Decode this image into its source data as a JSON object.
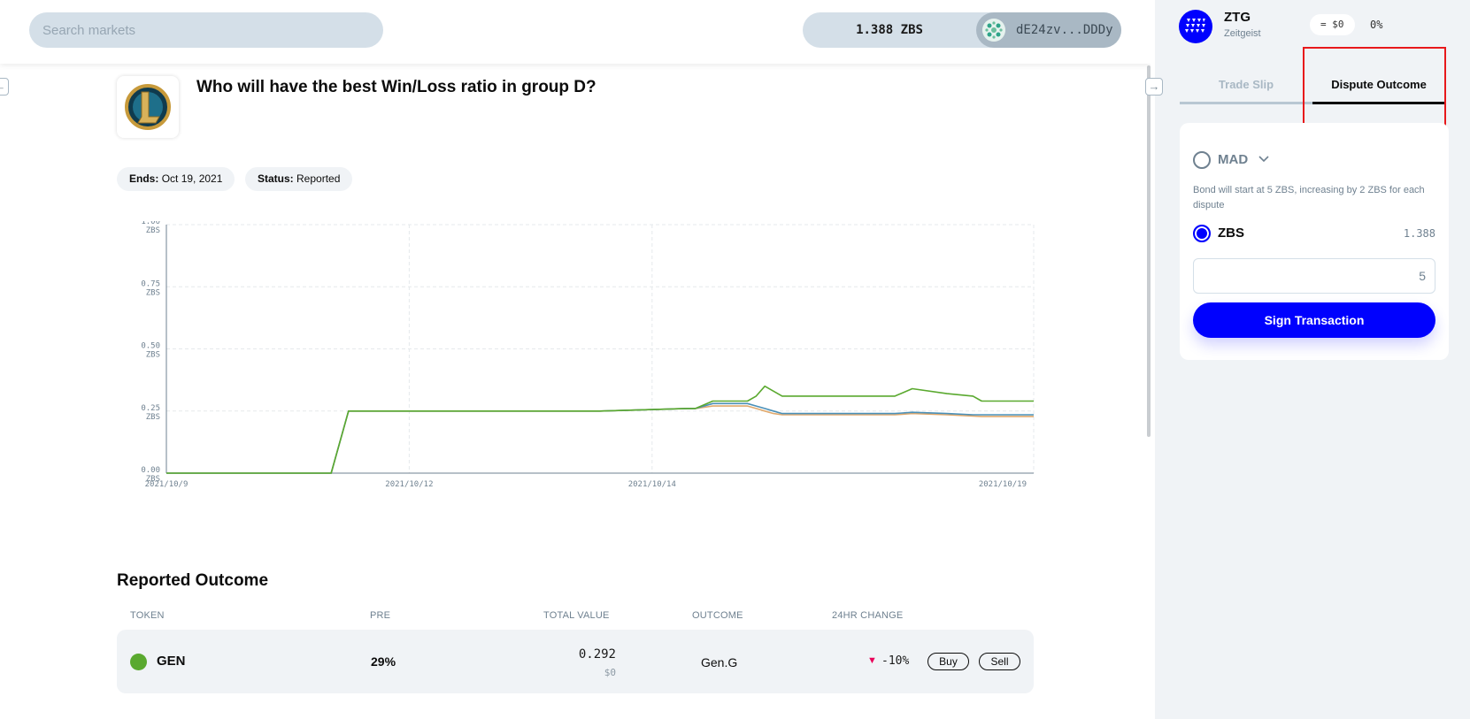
{
  "search": {
    "placeholder": "Search markets"
  },
  "wallet": {
    "balance": "1.388 ZBS",
    "address": "dE24zv...DDDy"
  },
  "market": {
    "question": "Who will have the best Win/Loss ratio in group D?",
    "ends_label": "Ends:",
    "ends_value": "Oct 19, 2021",
    "status_label": "Status:",
    "status_value": "Reported"
  },
  "chart_data": {
    "type": "line",
    "title": "",
    "xlabel": "",
    "ylabel": "",
    "x_ticks": [
      "2021/10/9",
      "2021/10/12",
      "2021/10/14",
      "2021/10/19"
    ],
    "y_ticks": [
      "0.00 ZBS",
      "0.25 ZBS",
      "0.50 ZBS",
      "0.75 ZBS",
      "1.00 ZBS"
    ],
    "ylim": [
      0,
      1
    ],
    "grid": true,
    "x": [
      0,
      0.19,
      0.21,
      0.35,
      0.5,
      0.6,
      0.61,
      0.63,
      0.67,
      0.68,
      0.69,
      0.7,
      0.71,
      0.75,
      0.84,
      0.86,
      0.9,
      0.93,
      0.94,
      1.0
    ],
    "series": [
      {
        "color": "#5aa92f",
        "values": [
          0,
          0,
          0.25,
          0.25,
          0.25,
          0.26,
          0.26,
          0.29,
          0.29,
          0.31,
          0.35,
          0.33,
          0.31,
          0.31,
          0.31,
          0.34,
          0.32,
          0.31,
          0.29,
          0.29
        ]
      },
      {
        "color": "#4a90b8",
        "values": [
          0,
          0,
          0.25,
          0.25,
          0.25,
          0.26,
          0.26,
          0.28,
          0.28,
          0.27,
          0.26,
          0.25,
          0.24,
          0.24,
          0.24,
          0.245,
          0.24,
          0.235,
          0.235,
          0.235
        ]
      },
      {
        "color": "#e0a96d",
        "values": [
          0,
          0,
          0.25,
          0.25,
          0.25,
          0.26,
          0.26,
          0.27,
          0.27,
          0.26,
          0.25,
          0.24,
          0.235,
          0.235,
          0.235,
          0.24,
          0.235,
          0.23,
          0.228,
          0.228
        ]
      }
    ],
    "colors": {
      "grid": "#e5e9ec",
      "axis": "#6f8190"
    }
  },
  "reported": {
    "title": "Reported Outcome",
    "columns": [
      "TOKEN",
      "PRE",
      "TOTAL VALUE",
      "OUTCOME",
      "24HR CHANGE"
    ],
    "row": {
      "token": "GEN",
      "pre": "29%",
      "total_value": "0.292",
      "total_usd": "$0",
      "outcome": "Gen.G",
      "change_arrow": "▼",
      "change": "-10%",
      "buy": "Buy",
      "sell": "Sell",
      "token_color": "#5aa92f"
    }
  },
  "sidebar": {
    "ztg_symbol": "ZTG",
    "ztg_name": "Zeitgeist",
    "ztg_price": "= $0",
    "ztg_change": "0%",
    "tabs": [
      "Trade Slip",
      "Dispute Outcome"
    ],
    "active_tab": "Dispute Outcome",
    "dispute": {
      "mad_label": "MAD",
      "bond_note": "Bond will start at 5 ZBS, increasing by 2 ZBS for each dispute",
      "zbs_label": "ZBS",
      "zbs_balance": "1.388",
      "amount_value": "5",
      "sign_button": "Sign Transaction"
    }
  },
  "colors": {
    "accent": "#0001fe",
    "highlight": "#e8181b",
    "negative": "#e90059"
  },
  "icons": {
    "collapse_left": "arrow-left-icon",
    "collapse_right": "arrow-right-icon",
    "chevron": "chevron-down-icon"
  }
}
